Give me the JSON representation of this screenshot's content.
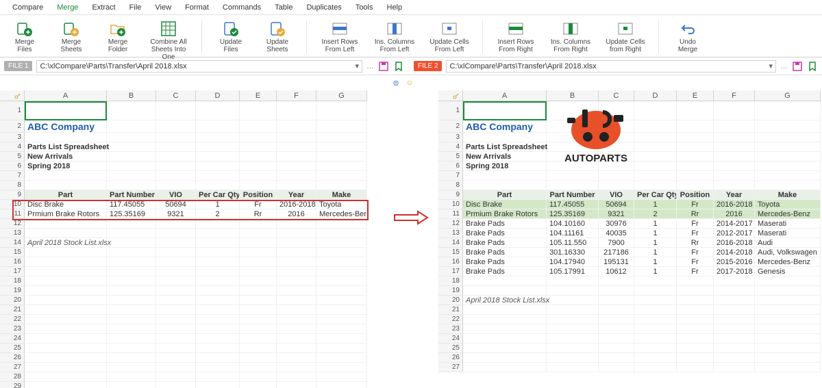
{
  "menu": [
    "Compare",
    "Merge",
    "Extract",
    "File",
    "View",
    "Format",
    "Commands",
    "Table",
    "Duplicates",
    "Tools",
    "Help"
  ],
  "menu_active": "Merge",
  "ribbon": {
    "items": [
      {
        "label": "Merge\nFiles"
      },
      {
        "label": "Merge\nSheets"
      },
      {
        "label": "Merge\nFolder"
      },
      {
        "label": "Combine All\nSheets Into One"
      },
      {
        "sep": true
      },
      {
        "label": "Update\nFiles"
      },
      {
        "label": "Update\nSheets"
      },
      {
        "sep": true
      },
      {
        "label": "Insert Rows\nFrom Left"
      },
      {
        "label": "Ins. Columns\nFrom Left"
      },
      {
        "label": "Update Cells\nFrom Left"
      },
      {
        "sep": true
      },
      {
        "label": "Insert Rows\nFrom Right"
      },
      {
        "label": "Ins. Columns\nFrom Right"
      },
      {
        "label": "Update Cells\nfrom Right"
      },
      {
        "sep": true
      },
      {
        "label": "Undo\nMerge"
      }
    ]
  },
  "file1": {
    "badge": "FILE 1",
    "path": "C:\\xlCompare\\Parts\\Transfer\\April 2018.xlsx"
  },
  "file2": {
    "badge": "FILE 2",
    "path": "C:\\xlCompare\\Parts\\Transfer\\April 2018.xlsx"
  },
  "columns": [
    "A",
    "B",
    "C",
    "D",
    "E",
    "F",
    "G"
  ],
  "left": {
    "company": "ABC Company",
    "sub1": "Parts List Spreadsheet",
    "sub2": "New Arrivals",
    "sub3": "Spring 2018",
    "headers": [
      "Part",
      "Part Number",
      "VIO",
      "Per Car Qty",
      "Position",
      "Year",
      "Make"
    ],
    "r10": [
      "Disc Brake",
      "117.45055",
      "50694",
      "1",
      "Fr",
      "2016-2018",
      "Toyota"
    ],
    "r11": [
      "Prmium Brake Rotors",
      "125.35169",
      "9321",
      "2",
      "Rr",
      "2016",
      "Mercedes-Benz"
    ],
    "footer": "April 2018 Stock List.xlsx"
  },
  "right": {
    "company": "ABC Company",
    "sub1": "Parts List Spreadsheet",
    "sub2": "New Arrivals",
    "sub3": "Spring 2018",
    "logo_text": "AUTOPARTS",
    "headers": [
      "Part",
      "Part Number",
      "VIO",
      "Per Car Qty",
      "Position",
      "Year",
      "Make"
    ],
    "r10": [
      "Disc Brake",
      "117.45055",
      "50694",
      "1",
      "Fr",
      "2016-2018",
      "Toyota"
    ],
    "r11": [
      "Prmium Brake Rotors",
      "125.35169",
      "9321",
      "2",
      "Rr",
      "2016",
      "Mercedes-Benz"
    ],
    "r12": [
      "Brake Pads",
      "104.10160",
      "30976",
      "1",
      "Fr",
      "2014-2017",
      "Maserati"
    ],
    "r13": [
      "Brake Pads",
      "104.11161",
      "40035",
      "1",
      "Fr",
      "2012-2017",
      "Maserati"
    ],
    "r14": [
      "Brake Pads",
      "105.11.550",
      "7900",
      "1",
      "Rr",
      "2016-2018",
      "Audi"
    ],
    "r15": [
      "Brake Pads",
      "301.16330",
      "217186",
      "1",
      "Fr",
      "2014-2018",
      "Audi, Volkswagen"
    ],
    "r16": [
      "Brake Pads",
      "104.17940",
      "195131",
      "1",
      "Fr",
      "2015-2016",
      "Mercedes-Benz"
    ],
    "r17": [
      "Brake Pads",
      "105.17991",
      "10612",
      "1",
      "Fr",
      "2017-2018",
      "Genesis"
    ],
    "footer": "April 2018 Stock List.xlsx"
  },
  "row_labels_left": [
    "1",
    "2",
    "3",
    "4",
    "5",
    "6",
    "7",
    "8",
    "9",
    "10",
    "11",
    "12",
    "13",
    "14",
    "15",
    "16",
    "17",
    "18",
    "19",
    "20",
    "21",
    "22",
    "23",
    "24",
    "25",
    "26",
    "27",
    "28",
    "29"
  ],
  "row_labels_right": [
    "1",
    "2",
    "3",
    "4",
    "5",
    "6",
    "7",
    "8",
    "9",
    "10",
    "11",
    "12",
    "13",
    "14",
    "15",
    "16",
    "17",
    "18",
    "19",
    "20",
    "21",
    "22",
    "23",
    "24",
    "25",
    "26",
    "27"
  ]
}
